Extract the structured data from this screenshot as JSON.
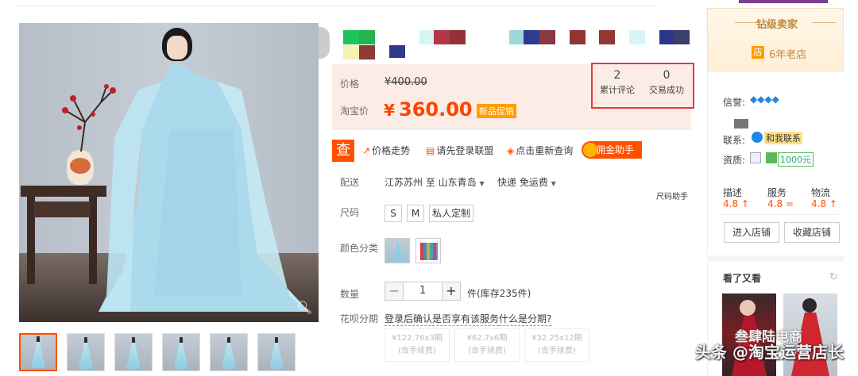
{
  "price": {
    "label_price": "价格",
    "old_price": "¥400.00",
    "label_taobao_price": "淘宝价",
    "currency": "¥",
    "current_price": "360.00",
    "promo_tag": "新品促销"
  },
  "stats": {
    "reviews_count": "2",
    "reviews_label": "累计评论",
    "deals_count": "0",
    "deals_label": "交易成功"
  },
  "tools": {
    "main_icon": "查",
    "price_trend": "价格走势",
    "login_alliance": "请先登录联盟",
    "requery": "点击重新查询",
    "commission": "佣金助手"
  },
  "delivery": {
    "label": "配送",
    "route": "江苏苏州 至 山东青岛",
    "method": "快递 免运费",
    "size_helper": "尺码助手"
  },
  "size": {
    "label": "尺码",
    "options": [
      "S",
      "M",
      "私人定制"
    ]
  },
  "color": {
    "label": "颜色分类"
  },
  "quantity": {
    "label": "数量",
    "value": "1",
    "stock": "件(库存235件)",
    "minus": "−",
    "plus": "+"
  },
  "installment": {
    "label": "花呗分期",
    "note": "登录后确认是否享有该服务",
    "link": "什么是分期?",
    "options": [
      {
        "line1": "¥122.76x3期",
        "line2": "(含手续费)"
      },
      {
        "line1": "¥62.7x6期",
        "line2": "(含手续费)"
      },
      {
        "line1": "¥32.25x12期",
        "line2": "(含手续费)"
      }
    ]
  },
  "seller": {
    "title": "钻级卖家",
    "badge": "店",
    "years": "6年老店",
    "reputation_label": "信誉:",
    "contact_label": "联系:",
    "contact_btn": "和我联系",
    "qualification_label": "资质:",
    "deposit": "1000元"
  },
  "scores": [
    {
      "label": "描述",
      "value": "4.8",
      "arrow": "↑"
    },
    {
      "label": "服务",
      "value": "4.8",
      "arrow": "="
    },
    {
      "label": "物流",
      "value": "4.8",
      "arrow": "↑"
    }
  ],
  "shop_buttons": {
    "enter": "进入店铺",
    "favorite": "收藏店铺"
  },
  "recommend": {
    "title": "看了又看",
    "refresh_icon": "↻"
  },
  "watermark": {
    "line1": "叁肆陆电商",
    "line2": "头条 @淘宝运营店长"
  },
  "colors": {
    "accent": "#ff5000",
    "price": "#ff4400",
    "panel": "#fbede6",
    "highlight_border": "#e4393c"
  }
}
